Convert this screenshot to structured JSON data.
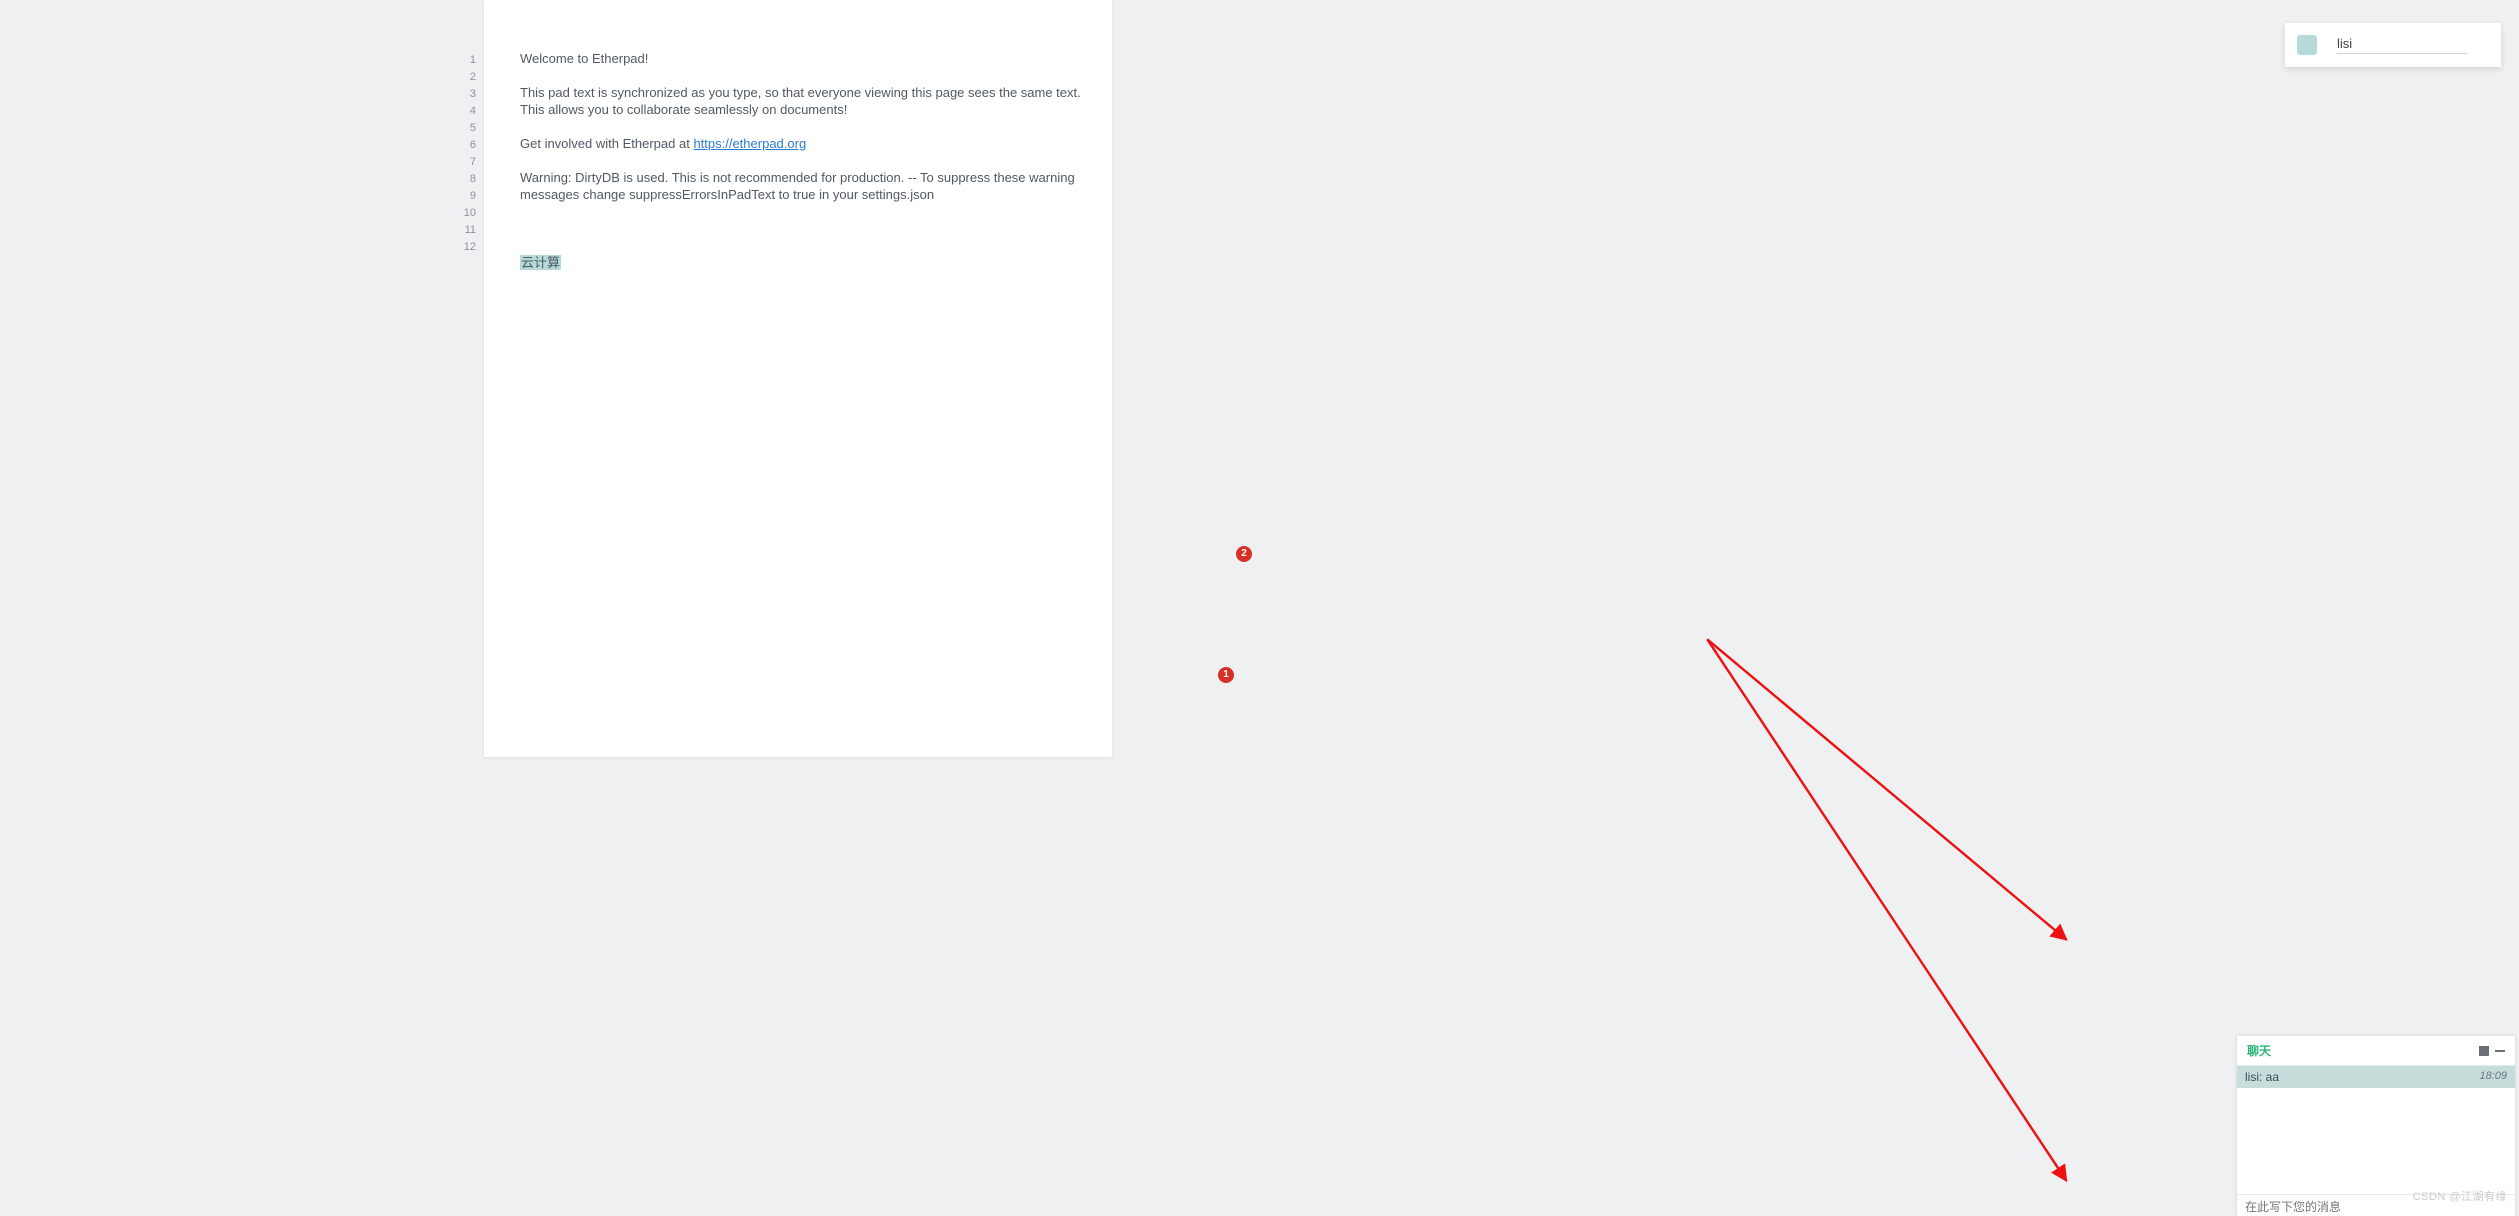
{
  "user_popover": {
    "name": "lisi",
    "color": "#b5dad8"
  },
  "gutter": [
    "1",
    "2",
    "3",
    "4",
    "5",
    "6",
    "7",
    "8",
    "9",
    "10",
    "11",
    "12"
  ],
  "pad": {
    "lines": [
      "Welcome to Etherpad!",
      "",
      "This pad text is synchronized as you type, so that everyone viewing this page sees the same text. This allows you to collaborate seamlessly on documents!",
      "",
      "Get involved with Etherpad at ",
      "",
      "Warning: DirtyDB is used. This is not recommended for production. -- To suppress these warning messages change suppressErrorsInPadText to true in your settings.json",
      "",
      "",
      "",
      "云计算",
      ""
    ],
    "link_text": "https://etherpad.org",
    "highlight_index": 10
  },
  "chat": {
    "title": "聊天",
    "messages": [
      {
        "author": "lisi",
        "text": "aa",
        "time": "18:09"
      }
    ],
    "input_placeholder": "在此写下您的消息"
  },
  "annotations": {
    "badge1": "1",
    "badge2": "2"
  },
  "watermark": "CSDN @江湖有缘"
}
